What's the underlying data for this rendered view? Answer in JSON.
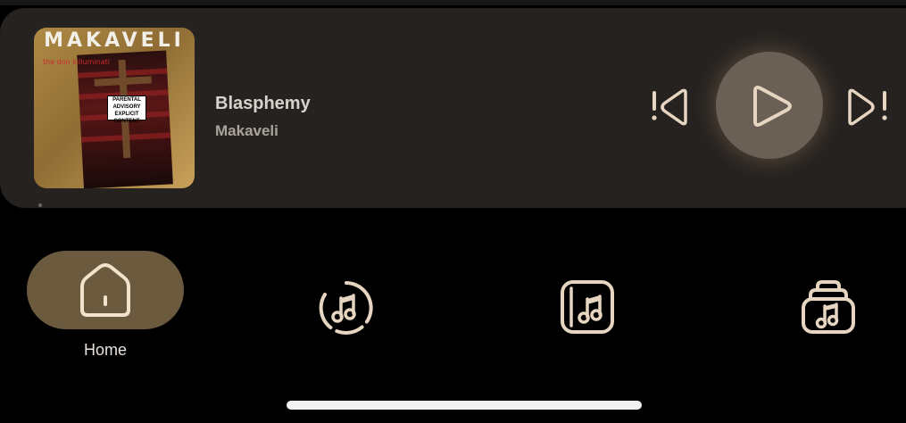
{
  "now_playing": {
    "title": "Blasphemy",
    "artist": "Makaveli",
    "album_art": {
      "artist_text": "MAKAVELI",
      "subtitle_text": "the don killuminati",
      "advisory_lines": [
        "PARENTAL",
        "ADVISORY",
        "EXPLICIT CONTENT"
      ]
    },
    "state": "paused"
  },
  "controls": {
    "previous_icon": "skip-previous-icon",
    "play_icon": "play-icon",
    "next_icon": "skip-next-icon"
  },
  "bottom_nav": {
    "items": [
      {
        "label": "Home",
        "icon": "home-icon",
        "selected": true
      },
      {
        "label": "",
        "icon": "music-disc-icon",
        "selected": false
      },
      {
        "label": "",
        "icon": "music-album-icon",
        "selected": false
      },
      {
        "label": "",
        "icon": "music-library-icon",
        "selected": false
      }
    ]
  },
  "colors": {
    "background": "#000000",
    "player_surface": "#262220",
    "accent": "#6c5a3f",
    "icon_tint": "#e6d5c0",
    "play_button": "#6b6056"
  }
}
